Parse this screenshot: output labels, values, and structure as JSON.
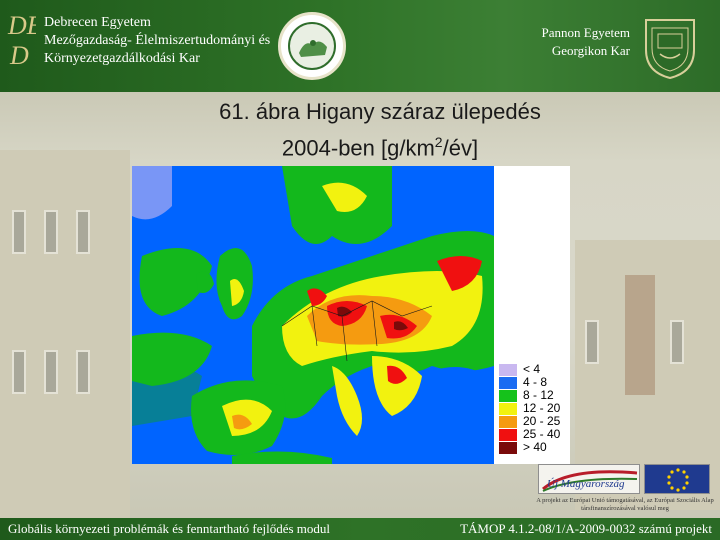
{
  "header": {
    "left_lines": [
      "Debrecen Egyetem",
      "Mezőgazdaság- Élelmiszertudományi és",
      "Környezetgazdálkodási Kar"
    ],
    "right_lines": [
      "Pannon Egyetem",
      "Georgikon Kar"
    ],
    "logo_left_mark": "DE",
    "seal_left_icon": "university-seal-icon",
    "crest_right_icon": "crest-icon"
  },
  "title": {
    "line1": "61. ábra Higany száraz ülepedés",
    "line2_prefix": "2004-ben [g/km",
    "line2_sup": "2",
    "line2_suffix": "/év]"
  },
  "map": {
    "region": "Europe",
    "sea_color": "#0064ff",
    "land_base_color": "#0db80d"
  },
  "legend": {
    "items": [
      {
        "label": "< 4",
        "color": "#c9b8f0"
      },
      {
        "label": "4 - 8",
        "color": "#1b6cf2"
      },
      {
        "label": "8 - 12",
        "color": "#15c21b"
      },
      {
        "label": "12 - 20",
        "color": "#f2f20f"
      },
      {
        "label": "20 - 25",
        "color": "#f59b10"
      },
      {
        "label": "25 - 40",
        "color": "#f01010"
      },
      {
        "label": "> 40",
        "color": "#7a0a0a"
      }
    ]
  },
  "bottom_logos": {
    "uj_magyarorszag_text": "Új Magyarország",
    "eu_icon": "eu-flag-icon",
    "support_text": "A projekt az Európai Unió támogatásával, az Európai Szociális Alap társfinanszírozásával valósul meg"
  },
  "footer": {
    "left": "Globális környezeti problémák és fenntartható fejlődés modul",
    "right": "TÁMOP 4.1.2-08/1/A-2009-0032 számú projekt"
  }
}
